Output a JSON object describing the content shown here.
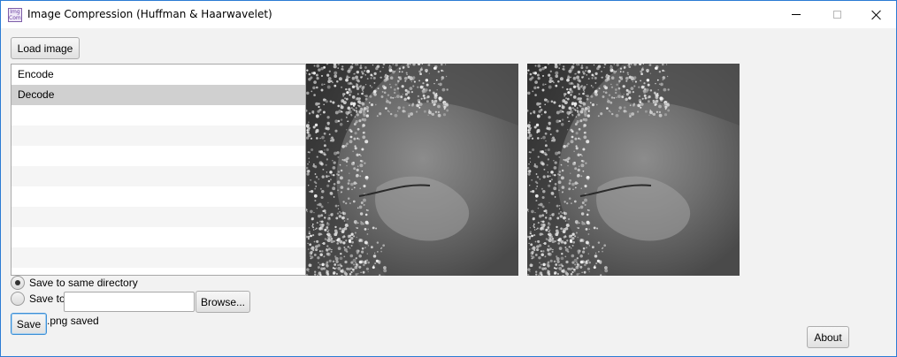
{
  "window": {
    "title": "Image Compression (Huffman & Haarwavelet)",
    "icon_text": "Img Comp",
    "controls": [
      "minimize-icon",
      "maximize-icon",
      "close-icon"
    ]
  },
  "toolbar": {
    "load_label": "Load image"
  },
  "list": {
    "items": [
      "Encode",
      "Decode"
    ],
    "selected": "Decode"
  },
  "images": {
    "original": {
      "description_icon": "satellite-cloud-image"
    },
    "decoded": {
      "description_icon": "satellite-cloud-image"
    }
  },
  "save_options": {
    "same_dir_label": "Save to same directory",
    "same_dir_checked": true,
    "save_to_label": "Save to",
    "save_to_checked": false,
    "path_value": "",
    "browse_label": "Browse..."
  },
  "actions": {
    "save_label": "Save",
    "status": ".png saved",
    "about_label": "About"
  },
  "colors": {
    "accent": "#2b7bd4",
    "selection": "#d0d0d0",
    "background": "#f2f2f2"
  }
}
